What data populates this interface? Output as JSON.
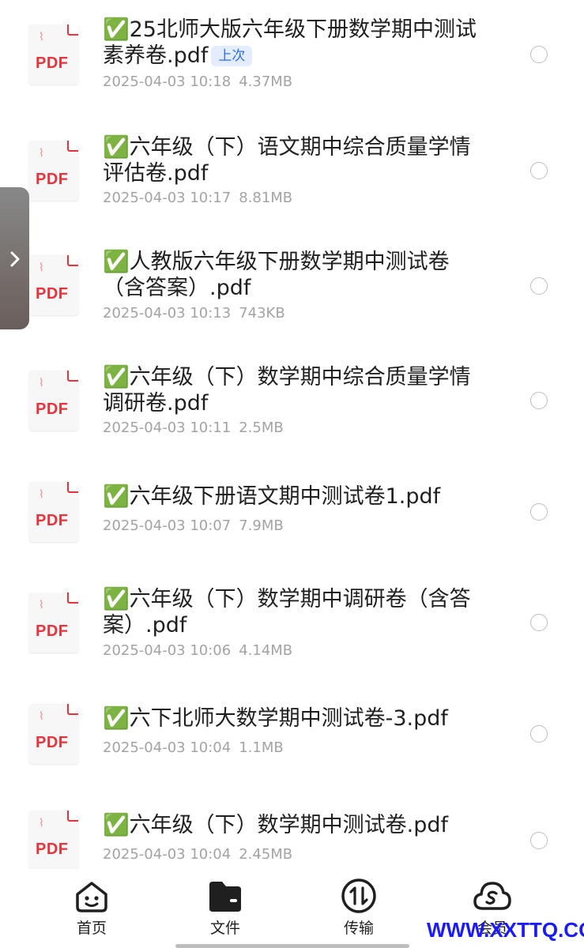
{
  "files": [
    {
      "name": "✅25北师大版六年级下册数学期中测试素养卷.pdf",
      "date": "2025-04-03 10:18",
      "size": "4.37MB",
      "badge": "上次"
    },
    {
      "name": "✅六年级（下）语文期中综合质量学情评估卷.pdf",
      "date": "2025-04-03 10:17",
      "size": "8.81MB"
    },
    {
      "name": "✅人教版六年级下册数学期中测试卷（含答案）.pdf",
      "date": "2025-04-03 10:13",
      "size": "743KB"
    },
    {
      "name": "✅六年级（下）数学期中综合质量学情调研卷.pdf",
      "date": "2025-04-03 10:11",
      "size": "2.5MB"
    },
    {
      "name": "✅六年级下册语文期中测试卷1.pdf",
      "date": "2025-04-03 10:07",
      "size": "7.9MB"
    },
    {
      "name": "✅六年级（下）数学期中调研卷（含答案）.pdf",
      "date": "2025-04-03 10:06",
      "size": "4.14MB"
    },
    {
      "name": "✅六下北师大数学期中测试卷-3.pdf",
      "date": "2025-04-03 10:04",
      "size": "1.1MB"
    },
    {
      "name": "✅六年级（下）数学期中测试卷.pdf",
      "date": "2025-04-03 10:04",
      "size": "2.45MB"
    }
  ],
  "file_icon_label": "PDF",
  "nav": {
    "home": "首页",
    "files": "文件",
    "transfer": "传输",
    "member": "会员"
  },
  "watermark": "WWW.XXTTQ.COM",
  "icons": {
    "side_tab": "chevron-right-icon",
    "home": "smiley-face-icon",
    "files": "folder-icon",
    "transfer": "transfer-arrows-icon",
    "member": "cloud-s-icon"
  },
  "colors": {
    "pdf_red": "#e8333c",
    "check_green": "#3aa845",
    "badge_blue": "#2a6cf5",
    "meta_gray": "#a3a3a3"
  }
}
